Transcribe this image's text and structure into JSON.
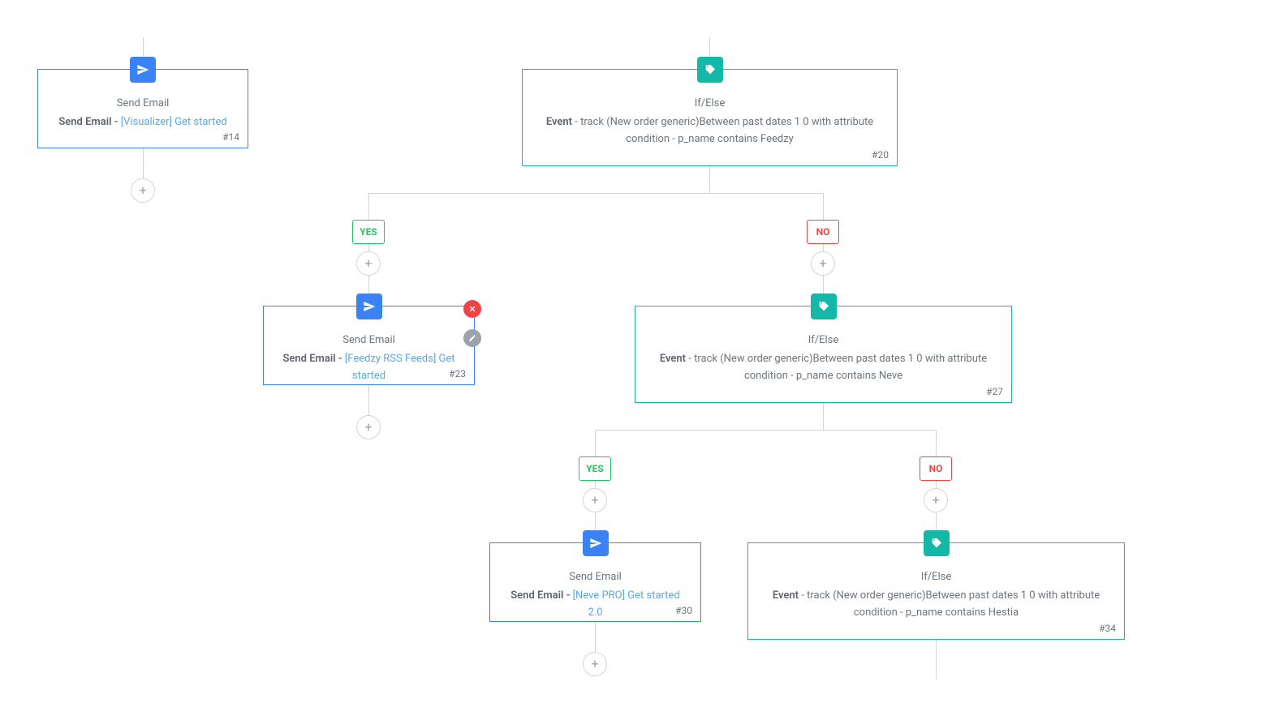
{
  "colors": {
    "email": "#3b82f6",
    "cond": "#14b8a6",
    "yes": "#22c55e",
    "no": "#ef4444",
    "link": "#5aa9e6"
  },
  "labels": {
    "yes": "YES",
    "no": "NO",
    "add": "+"
  },
  "nodes": {
    "n14": {
      "type": "email",
      "title": "Send Email",
      "descBold": "Send Email - ",
      "descLink": "[Visualizer] Get started",
      "tag": "#14"
    },
    "n20": {
      "type": "cond",
      "title": "If/Else",
      "descBold": "Event",
      "descRest": " - track (New order generic)Between past dates 1 0 with attribute condition - p_name contains Feedzy",
      "tag": "#20"
    },
    "n23": {
      "type": "email",
      "title": "Send Email",
      "descBold": "Send Email - ",
      "descLink": "[Feedzy RSS Feeds] Get started",
      "tag": "#23"
    },
    "n27": {
      "type": "cond",
      "title": "If/Else",
      "descBold": "Event",
      "descRest": " - track (New order generic)Between past dates 1 0 with attribute condition - p_name contains Neve",
      "tag": "#27"
    },
    "n30": {
      "type": "email",
      "title": "Send Email",
      "descBold": "Send Email - ",
      "descLink": "[Neve PRO] Get started 2.0",
      "tag": "#30"
    },
    "n34": {
      "type": "cond",
      "title": "If/Else",
      "descBold": "Event",
      "descRest": " - track (New order generic)Between past dates 1 0 with attribute condition - p_name contains Hestia",
      "tag": "#34"
    }
  }
}
